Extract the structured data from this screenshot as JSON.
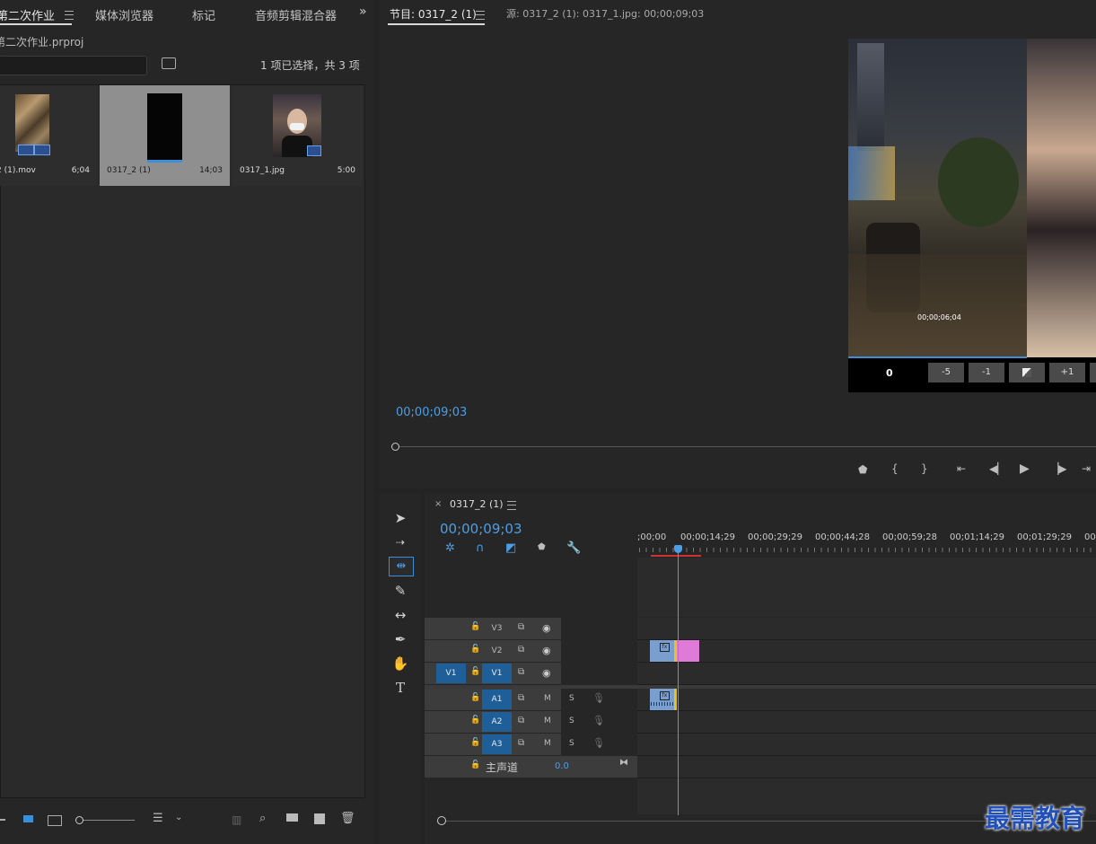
{
  "project_panel": {
    "tabs": [
      "第二次作业",
      "媒体浏览器",
      "标记",
      "音频剪辑混合器"
    ],
    "project_file": "第二次作业.prproj",
    "search_placeholder": "",
    "selection_status": "1 项已选择，共 3 项",
    "items": [
      {
        "name": "2 (1).mov",
        "duration": "6;04"
      },
      {
        "name": "0317_2 (1)",
        "duration": "14;03"
      },
      {
        "name": "0317_1.jpg",
        "duration": "5:00"
      }
    ]
  },
  "monitor": {
    "program_tab": "节目: 0317_2 (1)",
    "source_tab": "源: 0317_2 (1): 0317_1.jpg: 00;00;09;03",
    "timecode": "00;00;09;03",
    "overlay_timecode": "00;00;06;04",
    "transition_value": "0",
    "trim_buttons": [
      "-5",
      "-1",
      "",
      "+1"
    ]
  },
  "timeline": {
    "sequence_tab": "0317_2 (1)",
    "timecode": "00;00;09;03",
    "ruler_labels": [
      ";00;00",
      "00;00;14;29",
      "00;00;29;29",
      "00;00;44;28",
      "00;00;59;28",
      "00;01;14;29",
      "00;01;29;29",
      "00"
    ],
    "video_tracks": [
      "V3",
      "V2",
      "V1"
    ],
    "source_patch": "V1",
    "audio_tracks": [
      "A1",
      "A2",
      "A3"
    ],
    "mute_label": "M",
    "solo_label": "S",
    "master_label": "主声道",
    "master_value": "0.0",
    "clip_label": "fx"
  },
  "watermark": "最需教育",
  "colors": {
    "accent": "#4a9fe8",
    "v2_clip": "#e07ad8",
    "clip_blue": "#7a9fcf",
    "playhead": "#4a9fe8"
  }
}
